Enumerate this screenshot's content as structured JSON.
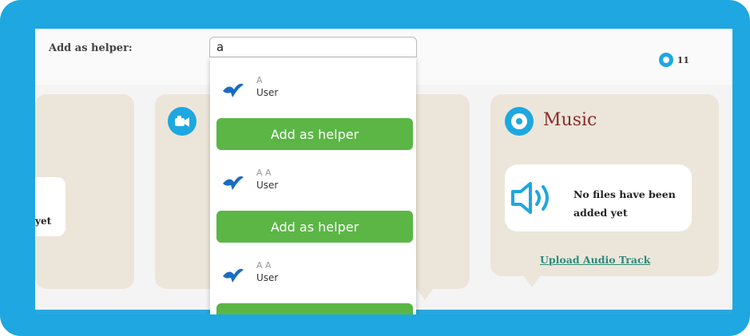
{
  "header": {
    "helper_label": "Add as helper:",
    "search_value": "a",
    "view_count": "11"
  },
  "search_results": [
    {
      "name": "A",
      "role": "User",
      "button_label": "Add as helper"
    },
    {
      "name": "A A",
      "role": "User",
      "button_label": "Add as helper"
    },
    {
      "name": "A A",
      "role": "User",
      "button_label": "Add as helper"
    }
  ],
  "left_card": {
    "partial_text": "yet"
  },
  "music": {
    "title": "Music",
    "empty_message": "No files have been added yet",
    "upload_link": "Upload Audio Track"
  },
  "colors": {
    "frame": "#1ea7e0",
    "button": "#5bb645",
    "card": "#ece6da",
    "music_title": "#8a2b2b",
    "link": "#2e8a7a"
  },
  "icons": [
    "eye-icon",
    "video-camera-icon",
    "music-disc-icon",
    "speaker-icon",
    "bird-avatar-icon"
  ]
}
